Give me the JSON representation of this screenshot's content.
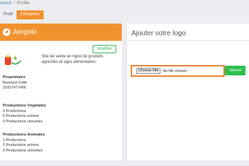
{
  "breadcrumb": {
    "home": "cceuil",
    "separator": "/",
    "current": "Profile"
  },
  "tabs": [
    {
      "label": "Profil"
    },
    {
      "label": "Entreprise"
    }
  ],
  "brand": {
    "name": "Jangolo",
    "color": "#f0922e",
    "icon": "leaf-icon"
  },
  "company": {
    "modify_label": "Modifier",
    "description": "Site de vente en ligne de produits agricoles et agro alimentaires."
  },
  "owner": {
    "heading": "Propriétaire",
    "name": "Bertrand Foffe",
    "phone": "31657477496"
  },
  "prod_veg": {
    "heading": "Productions Végétales",
    "total": "0 Productions",
    "active": "0 Productions actives",
    "closed": "0 Productions cloturées"
  },
  "prod_anim": {
    "heading": "Productions Animales",
    "total": "1 Productions",
    "active": "1 Productions actives",
    "closed": "0 Productions cloturées"
  },
  "logo_panel": {
    "title": "Ajouter votre logo",
    "choose_label": "Choose File",
    "file_status": "No file chosen",
    "upload_label": "Upload"
  },
  "colors": {
    "accent": "#f0922e",
    "success": "#2fbf4f"
  }
}
